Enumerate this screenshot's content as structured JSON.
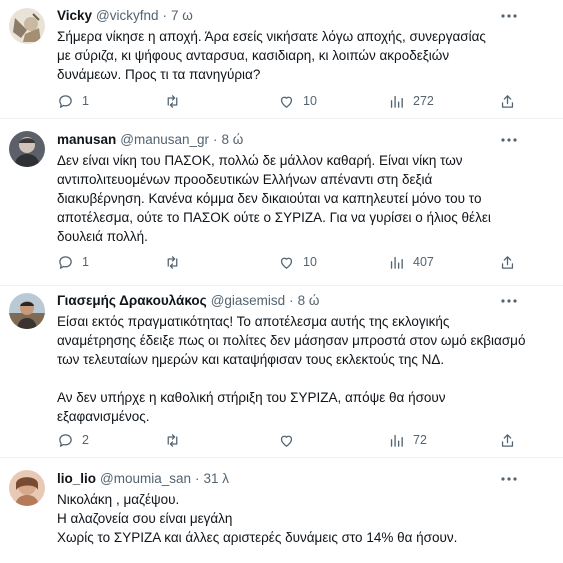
{
  "tweets": [
    {
      "name": "Vicky",
      "handle": "@vickyfnd",
      "time": "7 ω",
      "text": "Σήμερα νίκησε η αποχή. Άρα εσείς νικήσατε λόγω αποχής, συνεργασίας με σύριζα, κι ψήφους ανταρσυα, κασιδιαρη, κι λοιπών ακροδεξιών δυνάμεων. Προς τι τα πανηγύρια?",
      "replies": "1",
      "retweets": "",
      "likes": "10",
      "views": "272"
    },
    {
      "name": "manusan",
      "handle": "@manusan_gr",
      "time": "8 ώ",
      "text": "Δεν είναι νίκη του ΠΑΣΟΚ, πολλώ δε μάλλον καθαρή. Είναι νίκη των αντιπολιτευομένων προοδευτικών Ελλήνων απέναντι στη δεξιά διακυβέρνηση. Κανένα κόμμα δεν δικαιούται να καπηλευτεί μόνο του το αποτέλεσμα, ούτε το ΠΑΣΟΚ ούτε ο ΣΥΡΙΖΑ. Για να γυρίσει ο ήλιος θέλει δουλειά πολλή.",
      "replies": "1",
      "retweets": "",
      "likes": "10",
      "views": "407"
    },
    {
      "name": "Γιασεμής Δρακουλάκος",
      "handle": "@giasemisd",
      "time": "8 ώ",
      "text": "Είσαι εκτός πραγματικότητας! Το αποτέλεσμα αυτής της εκλογικής αναμέτρησης έδειξε πως οι πολίτες δεν μάσησαν μπροστά στον ωμό εκβιασμό των τελευταίων ημερών και καταψήφισαν τους εκλεκτούς της ΝΔ.\n\nΑν δεν υπήρχε η καθολική στήριξη του ΣΥΡΙΖΑ, απόψε θα ήσουν εξαφανισμένος.",
      "replies": "2",
      "retweets": "",
      "likes": "",
      "views": "72"
    },
    {
      "name": "lio_lio",
      "handle": "@moumia_san",
      "time": "31 λ",
      "text": "Νικολάκη , μαζέψου.\nΗ αλαζονεία σου είναι μεγάλη\nΧωρίς το ΣΥΡΙΖΑ και άλλες αριστερές δυνάμεις στο 14% θα ήσουν.",
      "replies": "",
      "retweets": "",
      "likes": "",
      "views": ""
    }
  ],
  "separator": "·",
  "colors": {
    "text": "#0f1419",
    "secondary": "#536471",
    "divider": "#eff3f4"
  }
}
